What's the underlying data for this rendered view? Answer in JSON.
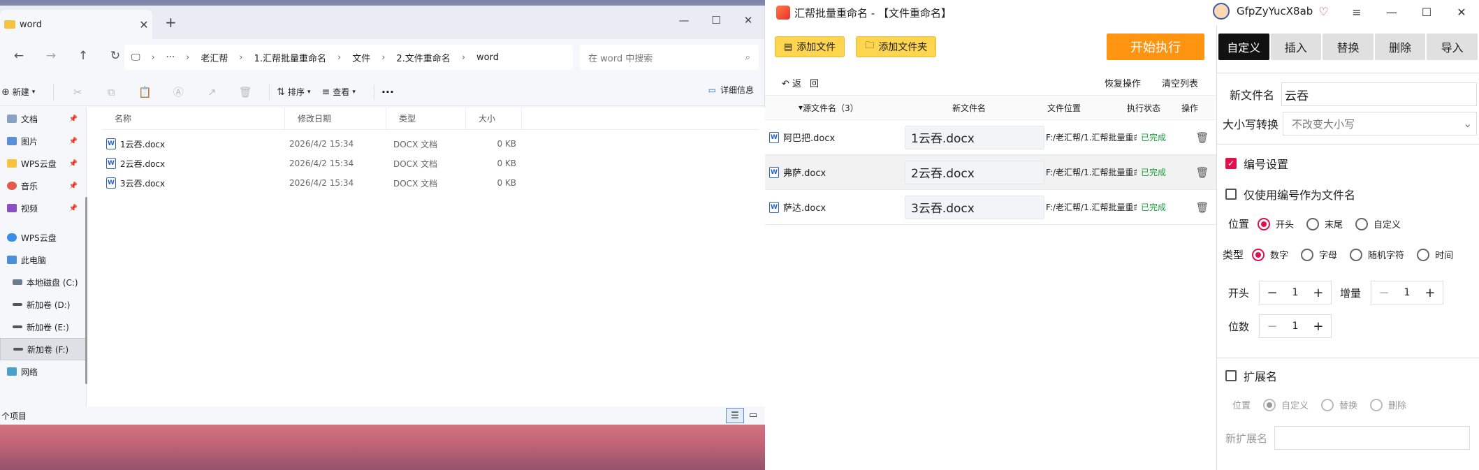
{
  "explorer": {
    "tab_title": "word",
    "tab_close": "✕",
    "new_tab": "+",
    "win": {
      "min": "—",
      "max": "☐",
      "close": "✕"
    },
    "breadcrumb": [
      "···",
      "老汇帮",
      "1.汇帮批量重命名",
      "文件",
      "2.文件重命名",
      "word"
    ],
    "search_placeholder": "在 word 中搜索",
    "cmd": {
      "new": "新建",
      "sort": "排序",
      "view": "查看",
      "more": "···",
      "details": "详细信息"
    },
    "nav": [
      {
        "label": "文档",
        "icon": "document-icon",
        "pin": true
      },
      {
        "label": "图片",
        "icon": "picture-icon",
        "pin": true
      },
      {
        "label": "WPS云盘",
        "icon": "folder-icon",
        "pin": true
      },
      {
        "label": "音乐",
        "icon": "music-icon",
        "pin": true
      },
      {
        "label": "视频",
        "icon": "video-icon",
        "pin": true
      },
      {
        "label": "WPS云盘",
        "icon": "cloud-icon",
        "pin": false
      },
      {
        "label": "此电脑",
        "icon": "computer-icon",
        "pin": false
      },
      {
        "label": "本地磁盘 (C:)",
        "icon": "disk-icon",
        "pin": false
      },
      {
        "label": "新加卷 (D:)",
        "icon": "drive-icon",
        "pin": false
      },
      {
        "label": "新加卷 (E:)",
        "icon": "drive-icon",
        "pin": false
      },
      {
        "label": "新加卷 (F:)",
        "icon": "drive-icon",
        "pin": false
      },
      {
        "label": "网络",
        "icon": "network-icon",
        "pin": false
      }
    ],
    "columns": [
      "名称",
      "修改日期",
      "类型",
      "大小"
    ],
    "files": [
      {
        "name": "1云吞.docx",
        "date": "2026/4/2 15:34",
        "type": "DOCX 文档",
        "size": "0 KB"
      },
      {
        "name": "2云吞.docx",
        "date": "2026/4/2 15:34",
        "type": "DOCX 文档",
        "size": "0 KB"
      },
      {
        "name": "3云吞.docx",
        "date": "2026/4/2 15:34",
        "type": "DOCX 文档",
        "size": "0 KB"
      }
    ],
    "status": "个项目"
  },
  "app": {
    "title": "汇帮批量重命名 - 【文件重命名】",
    "user": "GfpZyYucX8ab",
    "add_file": "添加文件",
    "add_folder": "添加文件夹",
    "start": "开始执行",
    "back": "返",
    "redo": "回",
    "restore": "恢复操作",
    "clear": "清空列表",
    "table_headers": {
      "src": "源文件名（3）",
      "new": "新文件名",
      "loc": "文件位置",
      "status": "执行状态",
      "op": "操作"
    },
    "rows": [
      {
        "src": "阿巴把.docx",
        "new": "1云吞.docx",
        "loc": "F:/老汇帮/1.汇帮批量重命名",
        "status": "已完成"
      },
      {
        "src": "弗萨.docx",
        "new": "2云吞.docx",
        "loc": "F:/老汇帮/1.汇帮批量重命名",
        "status": "已完成"
      },
      {
        "src": "萨达.docx",
        "new": "3云吞.docx",
        "loc": "F:/老汇帮/1.汇帮批量重命名",
        "status": "已完成"
      }
    ],
    "tabs": [
      "自定义",
      "插入",
      "替换",
      "删除",
      "导入"
    ],
    "settings": {
      "new_name_label": "新文件名",
      "new_name_value": "云吞",
      "case_label": "大小写转换",
      "case_value": "不改变大小写",
      "numbering_label": "编号设置",
      "only_number_label": "仅使用编号作为文件名",
      "position_label": "位置",
      "position_options": [
        "开头",
        "末尾",
        "自定义"
      ],
      "type_label": "类型",
      "type_options": [
        "数字",
        "字母",
        "随机字符",
        "时间"
      ],
      "start_label": "开头",
      "start_value": "1",
      "inc_label": "增量",
      "inc_value": "1",
      "digits_label": "位数",
      "digits_value": "1",
      "ext_label": "扩展名",
      "ext_pos_label": "位置",
      "ext_options": [
        "自定义",
        "替换",
        "删除"
      ],
      "new_ext_label": "新扩展名"
    }
  }
}
